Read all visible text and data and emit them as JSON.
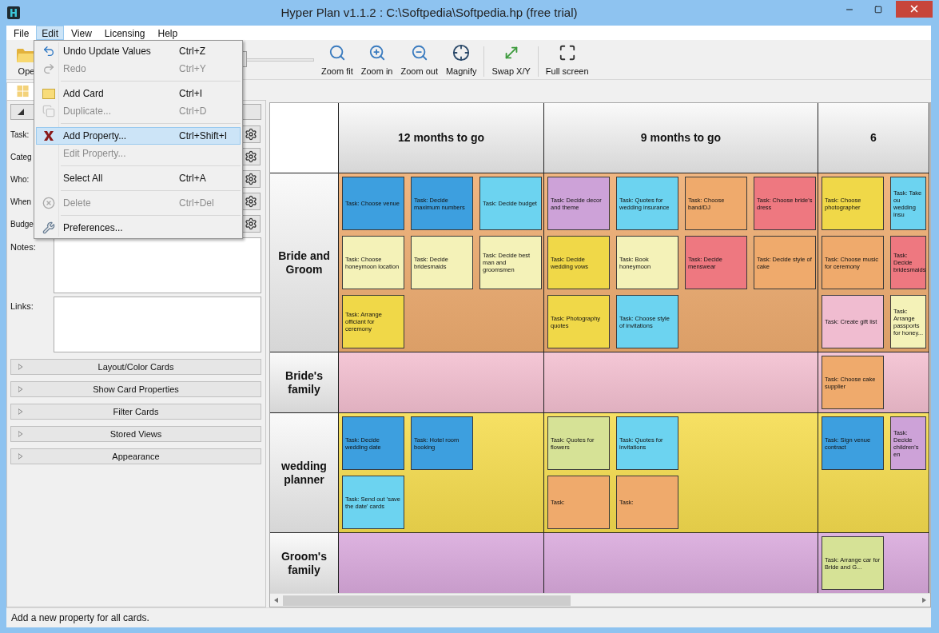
{
  "window": {
    "title": "Hyper Plan v1.1.2 : C:\\Softpedia\\Softpedia.hp (free trial)"
  },
  "menu_bar": [
    {
      "label": "File",
      "selected": false
    },
    {
      "label": "Edit",
      "selected": true
    },
    {
      "label": "View",
      "selected": false
    },
    {
      "label": "Licensing",
      "selected": false
    },
    {
      "label": "Help",
      "selected": false
    }
  ],
  "toolbar": {
    "open_label": "Ope",
    "zoom_slider": {
      "level": 0.55
    },
    "buttons": [
      "Zoom fit",
      "Zoom in",
      "Zoom out",
      "Magnify",
      "Swap X/Y",
      "Full screen"
    ]
  },
  "edit_menu": [
    {
      "kind": "item",
      "label": "Undo Update Values",
      "shortcut": "Ctrl+Z",
      "disabled": false,
      "selected": false
    },
    {
      "kind": "item",
      "label": "Redo",
      "shortcut": "Ctrl+Y",
      "disabled": true,
      "selected": false
    },
    {
      "kind": "separator"
    },
    {
      "kind": "item",
      "label": "Add Card",
      "shortcut": "Ctrl+I",
      "disabled": false,
      "selected": false
    },
    {
      "kind": "item",
      "label": "Duplicate...",
      "shortcut": "Ctrl+D",
      "disabled": true,
      "selected": false
    },
    {
      "kind": "separator"
    },
    {
      "kind": "item",
      "label": "Add Property...",
      "shortcut": "Ctrl+Shift+I",
      "disabled": false,
      "selected": true
    },
    {
      "kind": "item",
      "label": "Edit Property...",
      "disabled": true,
      "selected": false
    },
    {
      "kind": "separator"
    },
    {
      "kind": "item",
      "label": "Select All",
      "shortcut": "Ctrl+A",
      "disabled": false,
      "selected": false
    },
    {
      "kind": "separator"
    },
    {
      "kind": "item",
      "label": "Delete",
      "shortcut": "Ctrl+Del",
      "disabled": true,
      "selected": false
    },
    {
      "kind": "separator"
    },
    {
      "kind": "item",
      "label": "Preferences...",
      "disabled": false,
      "selected": false
    }
  ],
  "side_panel": {
    "fields": [
      "Task:",
      "Categ",
      "Who:",
      "When",
      "Budge"
    ],
    "notes_label": "Notes:",
    "links_label": "Links:",
    "sections": [
      "Layout/Color Cards",
      "Show Card Properties",
      "Filter Cards",
      "Stored Views",
      "Appearance"
    ]
  },
  "board": {
    "columns": [
      "12 months to go",
      "9 months to go",
      "6"
    ],
    "rows": [
      {
        "label": "Bride and Groom",
        "color": "#eeac70",
        "cells": [
          [
            {
              "text": "Task: Choose venue",
              "color": "#3d9fdf"
            },
            {
              "text": "Task: Decide maximum numbers",
              "color": "#3d9fdf"
            },
            {
              "text": "Task: Decide budget",
              "color": "#6cd3f0"
            },
            {
              "text": "Task: Choose honeymoon location",
              "color": "#f4f2b8"
            },
            {
              "text": "Task: Decide bridesmaids",
              "color": "#f4f2b8"
            },
            {
              "text": "Task: Decide best man and groomsmen",
              "color": "#f4f2b8"
            },
            {
              "text": "Task: Arrange officiant for ceremony",
              "color": "#f0d848"
            }
          ],
          [
            {
              "text": "Task: Decide decor and theme",
              "color": "#cda2d8"
            },
            {
              "text": "Task: Quotes for wedding insurance",
              "color": "#6cd3f0"
            },
            {
              "text": "Task: Choose band/DJ",
              "color": "#efaa6c"
            },
            {
              "text": "Task: Choose bride's dress",
              "color": "#ee7880"
            },
            {
              "text": "Task: Decide wedding vows",
              "color": "#f0d848"
            },
            {
              "text": "Task: Book honeymoon",
              "color": "#f4f2b8"
            },
            {
              "text": "Task: Decide menswear",
              "color": "#ee7880"
            },
            {
              "text": "Task: Decide style of cake",
              "color": "#efaa6c"
            },
            {
              "text": "Task: Photography quotes",
              "color": "#f0d848"
            },
            {
              "text": "Task: Choose style of invitations",
              "color": "#6cd3f0"
            }
          ],
          [
            {
              "text": "Task: Choose photographer",
              "color": "#f0d848"
            },
            {
              "text": "Task: Take ou wedding insu",
              "color": "#6cd3f0"
            },
            {
              "text": "Task: Choose music for ceremony",
              "color": "#efaa6c"
            },
            {
              "text": "Task: Decide bridesmaids",
              "color": "#ee7880"
            },
            {
              "text": "Task: Create gift list",
              "color": "#f0bcd0"
            },
            {
              "text": "Task: Arrange passports for honey...",
              "color": "#f4f2b8"
            }
          ]
        ]
      },
      {
        "label": "Bride's family",
        "color": "#f3bfd0",
        "cells": [
          [],
          [],
          [
            {
              "text": "Task: Choose cake supplier",
              "color": "#efaa6c"
            }
          ]
        ]
      },
      {
        "label": "wedding planner",
        "color": "#f5dc4e",
        "cells": [
          [
            {
              "text": "Task: Decide wedding date",
              "color": "#3d9fdf"
            },
            {
              "text": "Task: Hotel room booking",
              "color": "#3d9fdf"
            },
            {
              "text": "Task: Send out 'save the date' cards",
              "color": "#6cd3f0"
            }
          ],
          [
            {
              "text": "Task: Quotes for flowers",
              "color": "#d6e296"
            },
            {
              "text": "Task: Quotes for invitations",
              "color": "#6cd3f0"
            },
            {
              "text": "Task:",
              "color": "#efaa6c"
            },
            {
              "text": "Task:",
              "color": "#efaa6c"
            }
          ],
          [
            {
              "text": "Task: Sign venue contract",
              "color": "#3d9fdf"
            },
            {
              "text": "Task: Decide children's en",
              "color": "#cda2d8"
            }
          ]
        ]
      },
      {
        "label": "Groom's family",
        "color": "#d9a9dc",
        "cells": [
          [],
          [],
          [
            {
              "text": "Task: Arrange car for Bride and G...",
              "color": "#d6e296"
            }
          ]
        ]
      }
    ]
  },
  "status_bar": "Add a new property for all cards."
}
